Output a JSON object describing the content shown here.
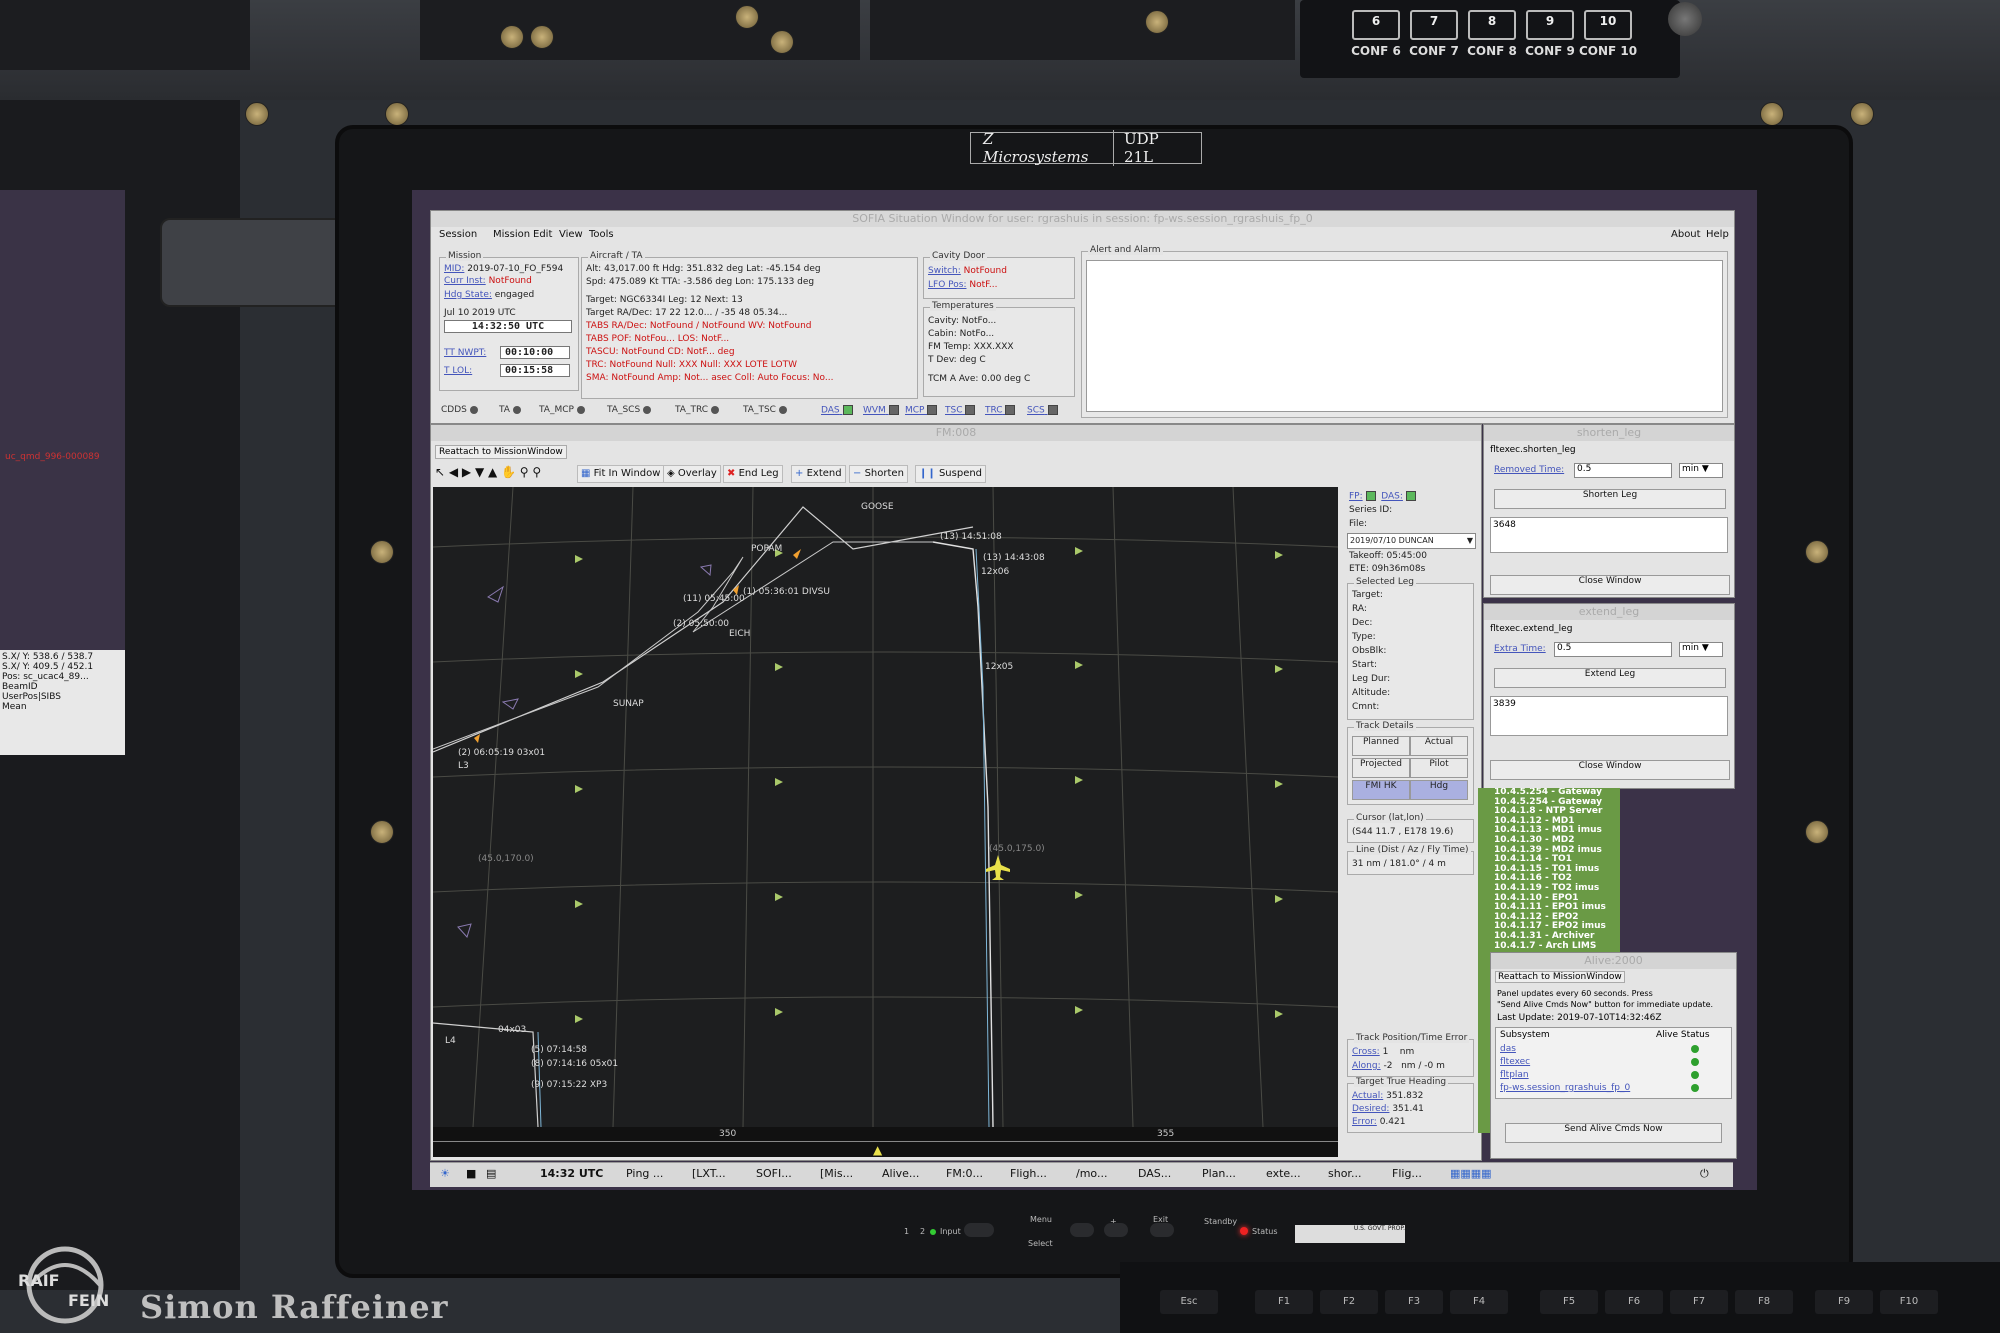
{
  "hardware": {
    "conf_buttons": [
      {
        "num": "6",
        "label": "CONF 6"
      },
      {
        "num": "7",
        "label": "CONF 7"
      },
      {
        "num": "8",
        "label": "CONF 8"
      },
      {
        "num": "9",
        "label": "CONF 9"
      },
      {
        "num": "10",
        "label": "CONF 10"
      }
    ],
    "brand": "Z Microsystems",
    "model": "UDP 21L",
    "ctrl_input": "Input",
    "ctrl_menu": "Menu",
    "ctrl_select": "Select",
    "ctrl_exit": "Exit",
    "ctrl_standby": "Standby",
    "ctrl_status": "Status",
    "ctrl_nums": [
      "1",
      "2"
    ],
    "ctrl_plus": "+",
    "asset_tag": "U.S. GOVT. PROP.",
    "keys": [
      "Esc",
      "F1",
      "F2",
      "F3",
      "F4",
      "F5",
      "F6",
      "F7",
      "F8",
      "F9",
      "F10"
    ]
  },
  "watermark": {
    "logo": "RAIF FEIN",
    "name": "Simon Raffeiner"
  },
  "left_screen": {
    "lines": [
      "uc_qmd_996-000089",
      "S.X/ Y: 538.6 / 538.7",
      "S.X/ Y: 409.5 / 452.1",
      "Pos: sc_ucac4_89...",
      "BeamID",
      "UserPos|SIBS",
      "Mean"
    ]
  },
  "app": {
    "title": "SOFIA Situation Window for user: rgrashuis  in session: fp-ws.session_rgrashuis_fp_0",
    "menus": [
      "Session",
      "Mission",
      "Edit",
      "View",
      "Tools"
    ],
    "menus_right": [
      "About",
      "Help"
    ],
    "mission": {
      "title": "Mission",
      "mid_label": "MID:",
      "mid_value": "2019-07-10_FO_F594",
      "curr_inst_label": "Curr Inst:",
      "curr_inst_value": "NotFound",
      "hdg_state_label": "Hdg State:",
      "hdg_state_value": "engaged",
      "date": "Jul 10 2019 UTC",
      "time": "14:32:50 UTC",
      "tt_nwpt_label": "TT NWPT:",
      "tt_nwpt_value": "00:10:00",
      "t_lol_label": "T LOL:",
      "t_lol_value": "00:15:58"
    },
    "aircraft": {
      "title": "Aircraft / TA",
      "rows": [
        "Alt: 43,017.00  ft    Hdg: 351.832  deg    Lat: -45.154   deg",
        "Spd: 475.089   Kt    TTA: -3.586   deg    Lon: 175.133   deg",
        "Target: NGC6334I                          Leg: 12  Next: 13",
        "Target RA/Dec: 17 22 12.0... / -35 48 05.34...",
        "TABS RA/Dec: NotFound      / NotFound      WV: NotFound",
        "TABS POF: NotFou...                       LOS: NotF...",
        "TASCU: NotFound                           CD: NotF...  deg",
        "TRC: NotFound      Null: XXX   Null: XXX   LOTE   LOTW",
        "SMA: NotFound      Amp: Not...  asec  Coll:    Auto Focus: No..."
      ]
    },
    "cavity_door": {
      "title": "Cavity Door",
      "switch_label": "Switch:",
      "switch_value": "NotFound",
      "lfo_label": "LFO Pos:",
      "lfo_value": "NotF..."
    },
    "temperatures": {
      "title": "Temperatures",
      "rows": [
        "Cavity: NotFo...",
        "Cabin: NotFo...",
        "FM Temp: XXX.XXX",
        "T Dev:             deg C",
        "TCM A Ave: 0.00     deg C"
      ]
    },
    "alert": {
      "title": "Alert and Alarm"
    },
    "status_items": [
      "CDDS",
      "TA",
      "TA_MCP",
      "TA_SCS",
      "TA_TRC",
      "TA_TSC"
    ],
    "status_items2": [
      "DAS",
      "WVM",
      "MCP",
      "TSC",
      "TRC",
      "SCS"
    ]
  },
  "fm": {
    "title": "FM:008",
    "reattach": "Reattach to MissionWindow",
    "toolbar": [
      "Fit In Window",
      "Overlay",
      "End Leg",
      "Extend",
      "Shorten",
      "Suspend"
    ],
    "map_labels": [
      "GOOSE",
      "POPAM",
      "(13) 14:51:08",
      "(13) 14:43:08",
      "12x06",
      "(11) 05:45:00",
      "(1) 05:36:01 DIVSU",
      "(2) 05:50:00",
      "EICH",
      "12x05",
      "SUNAP",
      "(2) 06:05:19  03x01",
      "L3",
      "(45.0,175.0)",
      "(45.0,170.0)",
      "L4",
      "04x03",
      "(5) 07:14:58",
      "(8) 07:14:16  05x01",
      "(9) 07:15:22  XP3"
    ],
    "scale_labels": [
      "350",
      "355"
    ],
    "side": {
      "fp_label": "FP:",
      "das_label": "DAS:",
      "series_id_label": "Series ID:",
      "file_label": "File:",
      "file_value": "2019/07/10 DUNCAN",
      "takeoff": "Takeoff: 05:45:00",
      "ete": "ETE: 09h36m08s",
      "selected_leg_title": "Selected Leg",
      "selected_leg_fields": [
        "Target:",
        "RA:",
        "Dec:",
        "Type:",
        "ObsBlk:",
        "Start:",
        "Leg Dur:",
        "Altitude:",
        "Cmnt:"
      ],
      "track_details_title": "Track Details",
      "track_buttons": [
        "Planned",
        "Actual",
        "Projected",
        "Pilot",
        "FMI HK",
        "Hdg"
      ],
      "cursor_title": "Cursor (lat,lon)",
      "cursor_value": "(S44 11.7 , E178 19.6)",
      "line_title": "Line (Dist / Az / Fly Time)",
      "line_value": "31 nm / 181.0° /  4 m",
      "tpe_title": "Track Position/Time Error",
      "cross_label": "Cross:",
      "cross_value": "1",
      "cross_unit": "nm",
      "along_label": "Along:",
      "along_value": "-2",
      "along_unit": "nm / -0 m",
      "tth_title": "Target True Heading",
      "actual_label": "Actual:",
      "actual_value": "351.832",
      "desired_label": "Desired:",
      "desired_value": "351.41",
      "error_label": "Error:",
      "error_value": "0.421"
    }
  },
  "shorten_leg": {
    "title": "shorten_leg",
    "subtitle": "fltexec.shorten_leg",
    "field_label": "Removed Time:",
    "field_value": "0.5",
    "unit": "min",
    "button": "Shorten Leg",
    "output": "3648",
    "close": "Close Window"
  },
  "extend_leg": {
    "title": "extend_leg",
    "subtitle": "fltexec.extend_leg",
    "field_label": "Extra Time:",
    "field_value": "0.5",
    "unit": "min",
    "button": "Extend Leg",
    "output": "3839",
    "close": "Close Window"
  },
  "netlist": [
    "10.4.5.254 - Gateway",
    "10.4.5.254 - Gateway",
    "10.4.1.8 - NTP Server",
    "10.4.1.12 - MD1",
    "10.4.1.13 - MD1 imus",
    "10.4.1.30 - MD2",
    "10.4.1.39 - MD2 imus",
    "10.4.1.14 - TO1",
    "10.4.1.15 - TO1 imus",
    "10.4.1.16 - TO2",
    "10.4.1.19 - TO2 imus",
    "10.4.1.10 - EPO1",
    "10.4.1.11 - EPO1 imus",
    "10.4.1.12 - EPO2",
    "10.4.1.17 - EPO2 imus",
    "10.4.1.31 - Archiver",
    "10.4.1.7 - Arch LIMS"
  ],
  "alive": {
    "title": "Alive:2000",
    "reattach": "Reattach to MissionWindow",
    "info1": "Panel updates every 60 seconds. Press",
    "info2": "\"Send Alive Cmds Now\" button for immediate update.",
    "last_update_label": "Last Update:",
    "last_update_value": "2019-07-10T14:32:46Z",
    "col_subsystem": "Subsystem",
    "col_status": "Alive Status",
    "subsystems": [
      "das",
      "fltexec",
      "fltplan",
      "fp-ws.session_rgrashuis_fp_0"
    ],
    "button": "Send Alive Cmds Now",
    "status_color": "#2ea02e"
  },
  "taskbar": {
    "clock": "14:32 UTC",
    "items": [
      "Ping ...",
      "[LXT...",
      "SOFI...",
      "[Mis...",
      "Alive...",
      "FM:0...",
      "Fligh...",
      "/mo...",
      "DAS...",
      "Plan...",
      "exte...",
      "shor...",
      "Flig..."
    ]
  },
  "colors": {
    "window_bg": "#e4e4e4",
    "map_bg": "#1d1e1f",
    "track": "#d9d9d9",
    "aircraft": "#e8e04a",
    "notfound": "#cc1111",
    "link": "#4455bb",
    "desktop": "#3b3248",
    "netlist": "#6a9a45"
  }
}
